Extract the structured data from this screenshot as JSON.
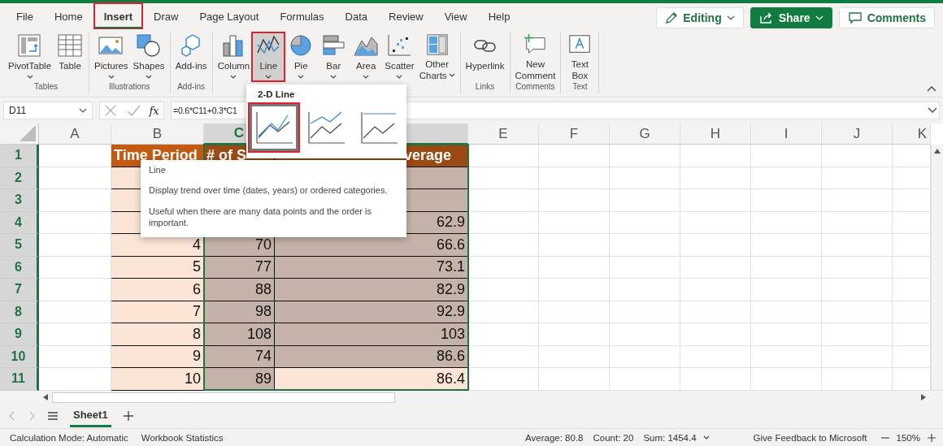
{
  "menu_tabs": [
    {
      "label": "File",
      "selected": false,
      "highlighted": false
    },
    {
      "label": "Home",
      "selected": false,
      "highlighted": false
    },
    {
      "label": "Insert",
      "selected": true,
      "highlighted": true
    },
    {
      "label": "Draw",
      "selected": false,
      "highlighted": false
    },
    {
      "label": "Page Layout",
      "selected": false,
      "highlighted": false
    },
    {
      "label": "Formulas",
      "selected": false,
      "highlighted": false
    },
    {
      "label": "Data",
      "selected": false,
      "highlighted": false
    },
    {
      "label": "Review",
      "selected": false,
      "highlighted": false
    },
    {
      "label": "View",
      "selected": false,
      "highlighted": false
    },
    {
      "label": "Help",
      "selected": false,
      "highlighted": false
    }
  ],
  "header_buttons": [
    {
      "kind": "editing",
      "label": "Editing"
    },
    {
      "kind": "share",
      "label": "Share"
    },
    {
      "kind": "comments",
      "label": "Comments"
    }
  ],
  "ribbon_groups": [
    {
      "label": "Tables",
      "items": [
        {
          "kind": "pivot",
          "lines": [
            "PivotTable"
          ],
          "dropdown": true
        },
        {
          "kind": "table",
          "lines": [
            "Table"
          ],
          "dropdown": false
        }
      ]
    },
    {
      "label": "Illustrations",
      "items": [
        {
          "kind": "picture",
          "lines": [
            "Pictures"
          ],
          "dropdown": true
        },
        {
          "kind": "shapes",
          "lines": [
            "Shapes"
          ],
          "dropdown": true
        }
      ]
    },
    {
      "label": "Add-ins",
      "items": [
        {
          "kind": "addins",
          "lines": [
            "Add-ins"
          ],
          "dropdown": false
        }
      ]
    },
    {
      "items": [
        {
          "kind": "column",
          "lines": [
            "Column"
          ],
          "dropdown": true,
          "selected": false,
          "highlighted": false
        },
        {
          "kind": "line",
          "lines": [
            "Line"
          ],
          "dropdown": true,
          "selected": true,
          "highlighted": true
        },
        {
          "kind": "pie",
          "lines": [
            "Pie"
          ],
          "dropdown": true,
          "selected": false,
          "highlighted": false
        },
        {
          "kind": "bar",
          "lines": [
            "Bar"
          ],
          "dropdown": true,
          "selected": false,
          "highlighted": false
        },
        {
          "kind": "area",
          "lines": [
            "Area"
          ],
          "dropdown": true,
          "selected": false,
          "highlighted": false
        },
        {
          "kind": "scatter",
          "lines": [
            "Scatter"
          ],
          "dropdown": true,
          "selected": false,
          "highlighted": false
        },
        {
          "kind": "other",
          "lines": [
            "Other",
            "Charts"
          ],
          "dropdown": true,
          "selected": false,
          "highlighted": false
        }
      ]
    },
    {
      "label": "Links",
      "items": [
        {
          "kind": "link",
          "lines": [
            "Hyperlink"
          ],
          "dropdown": false
        }
      ]
    },
    {
      "label": "Comments",
      "items": [
        {
          "kind": "comment",
          "lines": [
            "New",
            "Comment"
          ],
          "dropdown": false
        }
      ]
    },
    {
      "label": "Text",
      "items": [
        {
          "kind": "textbox",
          "lines": [
            "Text",
            "Box"
          ],
          "dropdown": false
        }
      ]
    }
  ],
  "formula_bar": {
    "name_box": "D11",
    "fx": "fx",
    "formula": "=0.6*C11+0.3*C1"
  },
  "columns": [
    {
      "label": "A",
      "selected": false
    },
    {
      "label": "B",
      "selected": false
    },
    {
      "label": "C",
      "selected": true
    },
    {
      "selected": true
    },
    {
      "label": "E",
      "selected": false
    },
    {
      "label": "F",
      "selected": false
    },
    {
      "label": "G",
      "selected": false
    },
    {
      "label": "H",
      "selected": false
    },
    {
      "label": "I",
      "selected": false
    },
    {
      "label": "J",
      "selected": false
    },
    {
      "label": "K",
      "selected": false
    }
  ],
  "rows": [
    {
      "label": "1",
      "selected": true,
      "kind": "header",
      "cells": [
        {
          "text": "Time Period",
          "selected": false
        },
        {
          "text": "# of S",
          "selected": true
        },
        {
          "text": "verage",
          "selected": true
        }
      ]
    },
    {
      "label": "2",
      "selected": true,
      "kind": "data",
      "cells": [
        {
          "selected": false
        },
        {},
        {
          "selected": true
        }
      ]
    },
    {
      "label": "3",
      "selected": true,
      "kind": "data",
      "cells": [
        {
          "selected": false
        },
        {},
        {
          "selected": true
        }
      ]
    },
    {
      "label": "4",
      "selected": true,
      "kind": "data",
      "cells": [
        {
          "selected": false
        },
        {},
        {
          "text": "62.9",
          "selected": true
        }
      ]
    },
    {
      "label": "5",
      "selected": true,
      "kind": "data",
      "cells": [
        {
          "text": "4",
          "selected": false
        },
        {
          "text": "70",
          "selected": true
        },
        {
          "text": "66.6",
          "selected": true
        }
      ]
    },
    {
      "label": "6",
      "selected": true,
      "kind": "data",
      "cells": [
        {
          "text": "5",
          "selected": false
        },
        {
          "text": "77",
          "selected": true
        },
        {
          "text": "73.1",
          "selected": true
        }
      ]
    },
    {
      "label": "7",
      "selected": true,
      "kind": "data",
      "cells": [
        {
          "text": "6",
          "selected": false
        },
        {
          "text": "88",
          "selected": true
        },
        {
          "text": "82.9",
          "selected": true
        }
      ]
    },
    {
      "label": "8",
      "selected": true,
      "kind": "data",
      "cells": [
        {
          "text": "7",
          "selected": false
        },
        {
          "text": "98",
          "selected": true
        },
        {
          "text": "92.9",
          "selected": true
        }
      ]
    },
    {
      "label": "9",
      "selected": true,
      "kind": "data",
      "cells": [
        {
          "text": "8",
          "selected": false
        },
        {
          "text": "108",
          "selected": true
        },
        {
          "text": "103",
          "selected": true
        }
      ]
    },
    {
      "label": "10",
      "selected": true,
      "kind": "data",
      "cells": [
        {
          "text": "9",
          "selected": false
        },
        {
          "text": "74",
          "selected": true
        },
        {
          "text": "86.6",
          "selected": true
        }
      ]
    },
    {
      "label": "11",
      "selected": true,
      "kind": "data",
      "cells": [
        {
          "text": "10",
          "selected": false
        },
        {
          "text": "89",
          "selected": true
        },
        {
          "text": "86.4",
          "selected": false
        }
      ]
    }
  ],
  "chart_dropdown": {
    "section": "2-D Line",
    "options": [
      {
        "kind": "line",
        "selected": true,
        "highlighted": true
      },
      {
        "kind": "stacked",
        "selected": false,
        "highlighted": false
      },
      {
        "kind": "percent",
        "selected": false,
        "highlighted": false
      }
    ]
  },
  "tooltip": {
    "title": "Line",
    "paragraphs": [
      "Display trend over time (dates, years) or ordered categories.",
      "Useful when there are many data points and the order is important."
    ]
  },
  "sheet_tabs": [
    {
      "label": "Sheet1",
      "selected": true
    }
  ],
  "status_bar": {
    "left": [
      "Calculation Mode: Automatic",
      "Workbook Statistics"
    ],
    "stats": [
      "Average: 80.8",
      "Count: 20",
      "Sum: 1454.4"
    ],
    "feedback": "Give Feedback to Microsoft",
    "zoom": "150%"
  }
}
